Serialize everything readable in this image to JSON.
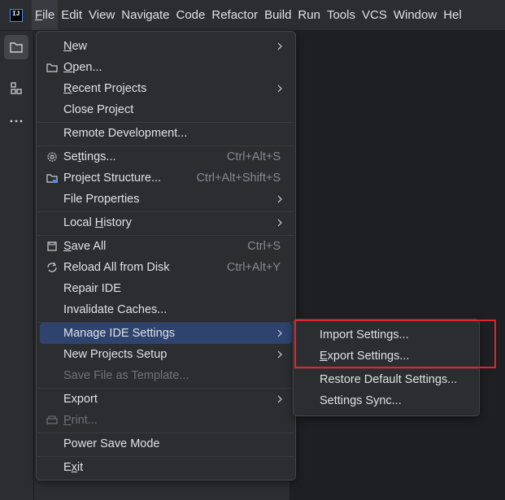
{
  "menubar": {
    "items": [
      "File",
      "Edit",
      "View",
      "Navigate",
      "Code",
      "Refactor",
      "Build",
      "Run",
      "Tools",
      "VCS",
      "Window",
      "Hel"
    ],
    "active_index": 0
  },
  "file_menu": {
    "items": [
      {
        "label": "New",
        "submenu": true
      },
      {
        "label": "Open...",
        "icon": "folder-icon"
      },
      {
        "label": "Recent Projects",
        "submenu": true
      },
      {
        "label": "Close Project"
      },
      {
        "label": "Remote Development..."
      },
      {
        "label": "Settings...",
        "shortcut": "Ctrl+Alt+S",
        "icon": "gear-icon"
      },
      {
        "label": "Project Structure...",
        "shortcut": "Ctrl+Alt+Shift+S",
        "icon": "project-structure-icon"
      },
      {
        "label": "File Properties",
        "submenu": true
      },
      {
        "label": "Local History",
        "submenu": true
      },
      {
        "label": "Save All",
        "shortcut": "Ctrl+S",
        "icon": "save-icon"
      },
      {
        "label": "Reload All from Disk",
        "shortcut": "Ctrl+Alt+Y",
        "icon": "reload-icon"
      },
      {
        "label": "Repair IDE"
      },
      {
        "label": "Invalidate Caches..."
      },
      {
        "label": "Manage IDE Settings",
        "submenu": true,
        "selected": true
      },
      {
        "label": "New Projects Setup",
        "submenu": true
      },
      {
        "label": "Save File as Template...",
        "disabled": true
      },
      {
        "label": "Export",
        "submenu": true
      },
      {
        "label": "Print...",
        "disabled": true,
        "icon": "print-icon"
      },
      {
        "label": "Power Save Mode"
      },
      {
        "label": "Exit"
      }
    ]
  },
  "manage_settings_submenu": {
    "items": [
      "Import Settings...",
      "Export Settings...",
      "Restore Default Settings...",
      "Settings Sync..."
    ]
  },
  "colors": {
    "selection": "#2e436e",
    "highlight_box": "#e0252b"
  }
}
